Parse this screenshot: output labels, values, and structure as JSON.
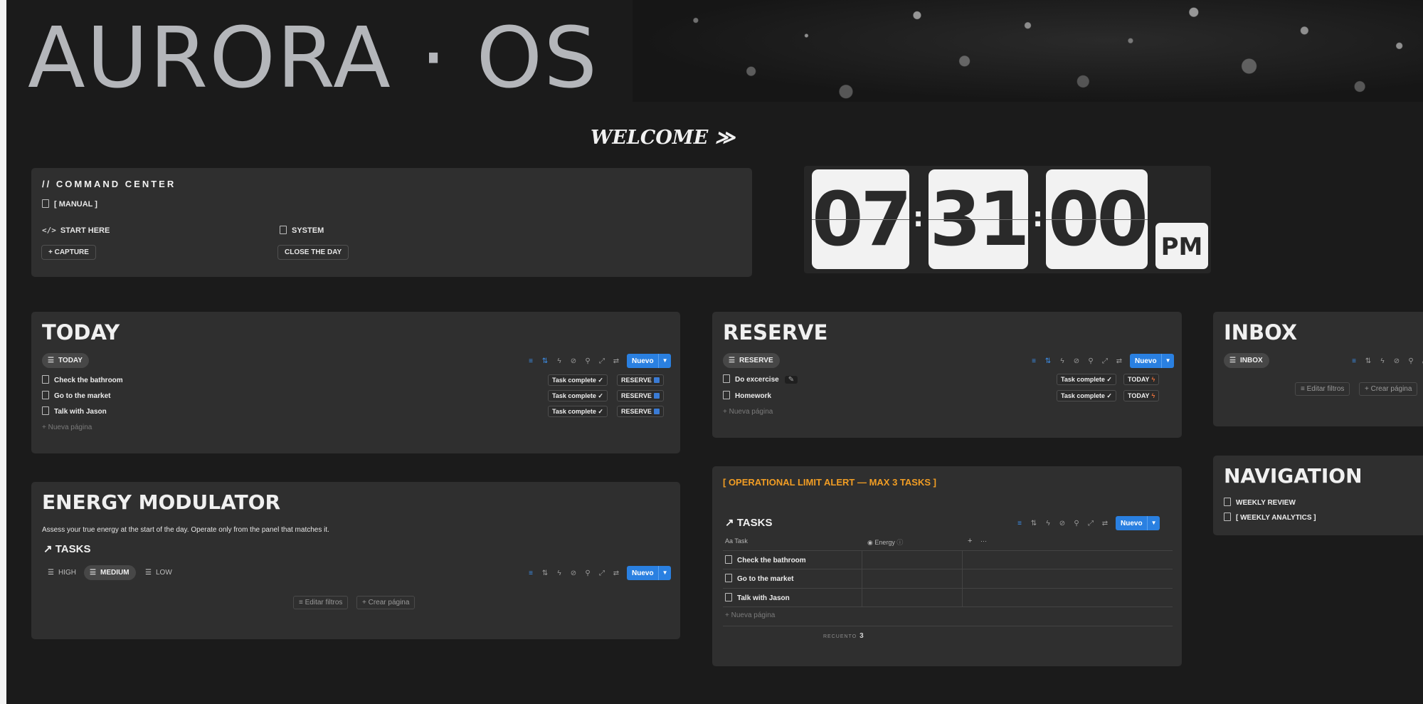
{
  "header": {
    "brand": "AURORA · OS"
  },
  "welcome": "WELCOME ≫",
  "command_center": {
    "title": "// COMMAND CENTER",
    "manual": "[ MANUAL ]",
    "start_here": "START HERE",
    "system": "SYSTEM",
    "capture": "+ CAPTURE",
    "close_day": "CLOSE THE DAY"
  },
  "clock": {
    "hours": "07",
    "minutes": "31",
    "seconds": "00",
    "ampm": "PM"
  },
  "toolbar": {
    "new_label": "Nuevo"
  },
  "today": {
    "title": "TODAY",
    "view": "TODAY",
    "items": [
      {
        "name": "Check the bathroom",
        "status": "Task complete ✓",
        "action": "RESERVE"
      },
      {
        "name": "Go to the market",
        "status": "Task complete ✓",
        "action": "RESERVE"
      },
      {
        "name": "Talk with Jason",
        "status": "Task complete ✓",
        "action": "RESERVE"
      }
    ],
    "new_page": "+   Nueva página"
  },
  "reserve": {
    "title": "RESERVE",
    "view": "RESERVE",
    "items": [
      {
        "name": "Do excercise",
        "status": "Task complete ✓",
        "action": "TODAY"
      },
      {
        "name": "Homework",
        "status": "Task complete ✓",
        "action": "TODAY"
      }
    ],
    "new_page": "+   Nueva página"
  },
  "inbox": {
    "title": "INBOX",
    "view": "INBOX",
    "edit_filters": "Editar filtros",
    "create_page": "+  Crear página"
  },
  "energy": {
    "title": "ENERGY MODULATOR",
    "description": "Assess your true energy at the start of the day. Operate only from the panel that matches it.",
    "tasks_link": "↗ TASKS",
    "views": [
      "HIGH",
      "MEDIUM",
      "LOW"
    ],
    "edit_filters": "Editar filtros",
    "create_page": "+  Crear página"
  },
  "alert": {
    "title": "[ OPERATIONAL LIMIT ALERT — MAX 3 TASKS ]",
    "tasks_link": "↗ TASKS",
    "columns": {
      "task": "Task",
      "energy": "Energy",
      "add": "+",
      "more": "···"
    },
    "rows": [
      "Check the bathroom",
      "Go to the market",
      "Talk with Jason"
    ],
    "new_page": "+   Nueva página",
    "count_label": "RECUENTO",
    "count_value": "3"
  },
  "navigation": {
    "title": "NAVIGATION",
    "items": [
      "WEEKLY REVIEW",
      "[ WEEKLY ANALYTICS ]"
    ]
  }
}
